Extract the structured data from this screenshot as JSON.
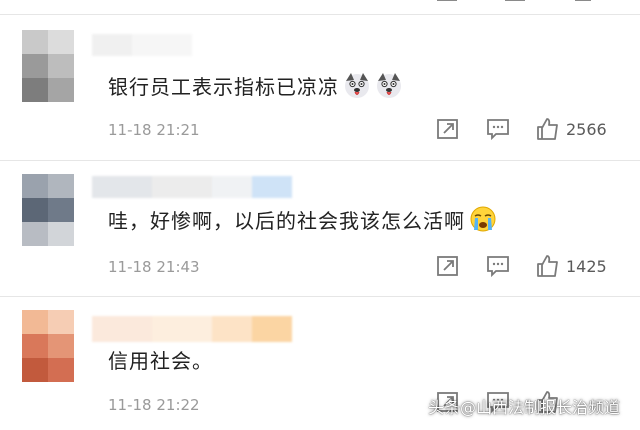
{
  "comments": [
    {
      "text": "银行员工表示指标已凉凉",
      "timestamp": "11-18 21:21",
      "likes": "2566",
      "emoji": [
        "husky-dog-icon",
        "husky-dog-icon"
      ]
    },
    {
      "text": "哇，好惨啊，以后的社会我该怎么活啊",
      "timestamp": "11-18 21:43",
      "likes": "1425",
      "emoji": [
        "crying-face-icon"
      ]
    },
    {
      "text": "信用社会。",
      "timestamp": "11-18 21:22",
      "likes": "",
      "emoji": []
    }
  ],
  "icons": {
    "share": "share-icon",
    "reply": "comment-icon",
    "like": "thumbs-up-icon"
  },
  "watermark": "头条@山西法制报长治频道",
  "colors": {
    "text": "#222222",
    "meta": "#9a9a9a",
    "icon": "#7a7a7a",
    "divider": "#e6e6e6"
  }
}
